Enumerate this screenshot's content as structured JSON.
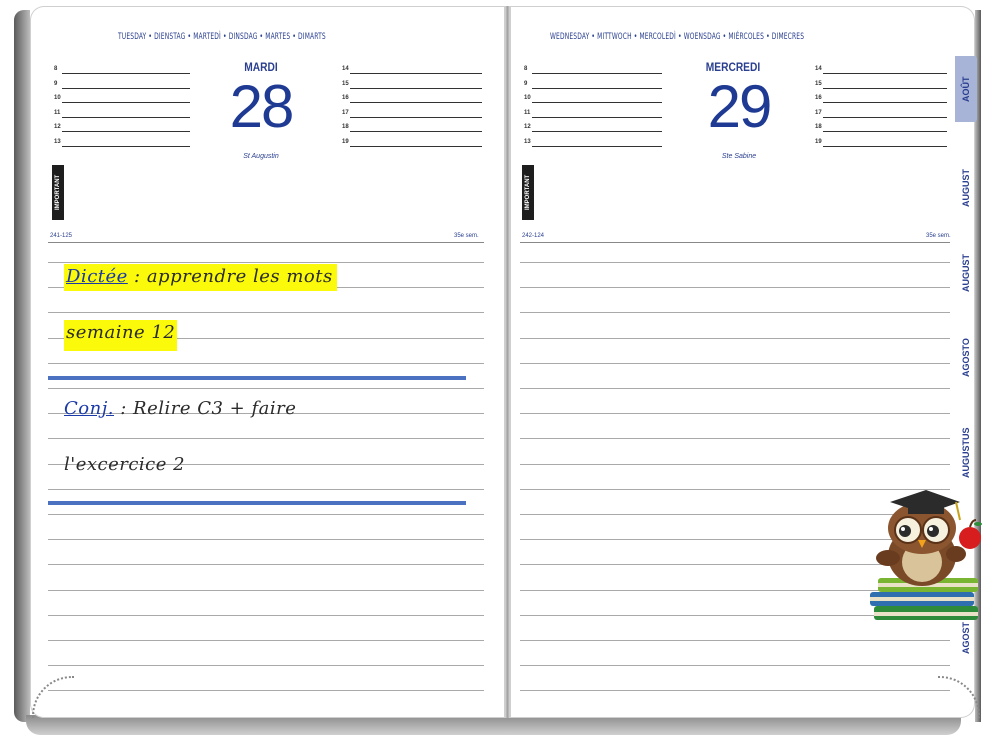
{
  "left_page": {
    "languages": "TUESDAY • DIENSTAG • MARTEDÌ • DINSDAG • MARTES • DIMARTS",
    "day_name": "MARDI",
    "day_number": "28",
    "saint": "St Augustin",
    "hours_left": [
      "8",
      "9",
      "10",
      "11",
      "12",
      "13"
    ],
    "hours_right": [
      "14",
      "15",
      "16",
      "17",
      "18",
      "19"
    ],
    "important": "IMPORTANT",
    "day_count": "241-125",
    "week": "35e sem."
  },
  "right_page": {
    "languages": "WEDNESDAY • MITTWOCH • MERCOLEDÌ • WOENSDAG • MIÉRCOLES • DIMECRES",
    "day_name": "MERCREDI",
    "day_number": "29",
    "saint": "Ste Sabine",
    "hours_left": [
      "8",
      "9",
      "10",
      "11",
      "12",
      "13"
    ],
    "hours_right": [
      "14",
      "15",
      "16",
      "17",
      "18",
      "19"
    ],
    "important": "IMPORTANT",
    "day_count": "242-124",
    "week": "35e sem."
  },
  "notes": {
    "dictee_label": "Dictée",
    "dictee_text": " : apprendre les mots",
    "dictee_line2": "semaine 12",
    "conj_label": "Conj.",
    "conj_text": " : Relire C3 + faire",
    "conj_line2": "l'excercice 2"
  },
  "month_tabs": [
    "AOÛT",
    "AUGUST",
    "AUGUST",
    "AGOSTO",
    "AUGUSTUS",
    "AGOST"
  ],
  "colors": {
    "blue_text": "#2a3f8f",
    "highlight": "#fafa0a",
    "blue_rule": "#4a72c0",
    "active_tab": "#a7b4d8"
  }
}
